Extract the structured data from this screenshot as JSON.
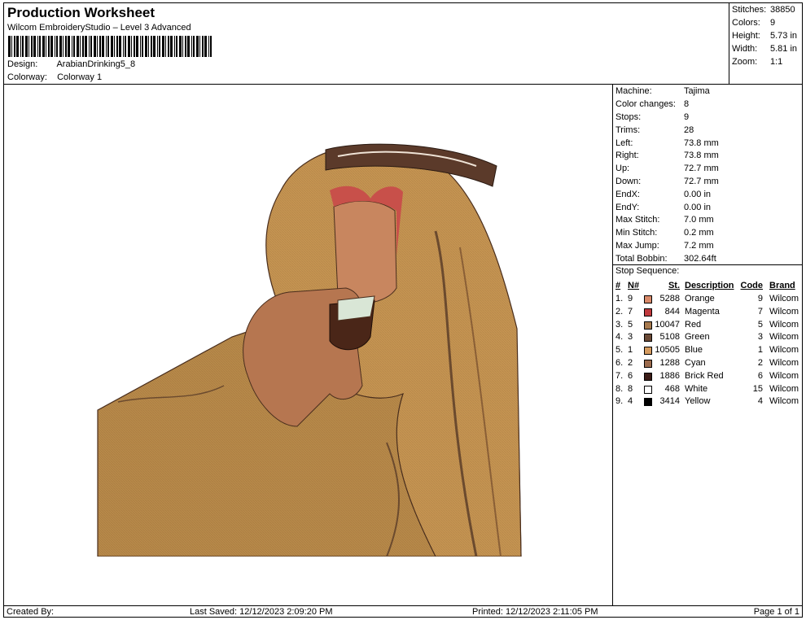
{
  "header": {
    "title": "Production Worksheet",
    "subtitle": "Wilcom EmbroideryStudio – Level 3 Advanced",
    "design_label": "Design:",
    "design_value": "ArabianDrinking5_8",
    "colorway_label": "Colorway:",
    "colorway_value": "Colorway 1"
  },
  "summary": [
    {
      "k": "Stitches:",
      "v": "38850"
    },
    {
      "k": "Colors:",
      "v": "9"
    },
    {
      "k": "Height:",
      "v": "5.73 in"
    },
    {
      "k": "Width:",
      "v": "5.81 in"
    },
    {
      "k": "Zoom:",
      "v": "1:1"
    }
  ],
  "machine": [
    {
      "k": "Machine:",
      "v": "Tajima"
    },
    {
      "k": "Color changes:",
      "v": "8"
    },
    {
      "k": "Stops:",
      "v": "9"
    },
    {
      "k": "Trims:",
      "v": "28"
    },
    {
      "k": "Left:",
      "v": "73.8 mm"
    },
    {
      "k": "Right:",
      "v": "73.8 mm"
    },
    {
      "k": "Up:",
      "v": "72.7 mm"
    },
    {
      "k": "Down:",
      "v": "72.7 mm"
    },
    {
      "k": "EndX:",
      "v": "0.00 in"
    },
    {
      "k": "EndY:",
      "v": "0.00 in"
    },
    {
      "k": "Max Stitch:",
      "v": "7.0 mm"
    },
    {
      "k": "Min Stitch:",
      "v": "0.2 mm"
    },
    {
      "k": "Max Jump:",
      "v": "7.2 mm"
    },
    {
      "k": "Total Bobbin:",
      "v": "302.64ft"
    }
  ],
  "stop_sequence": {
    "title": "Stop Sequence:",
    "headers": {
      "num": "#",
      "n": "N#",
      "st": "St.",
      "desc": "Description",
      "code": "Code",
      "brand": "Brand"
    },
    "rows": [
      {
        "num": "1.",
        "n": "9",
        "color": "#d98a6a",
        "st": "5288",
        "desc": "Orange",
        "code": "9",
        "brand": "Wilcom"
      },
      {
        "num": "2.",
        "n": "7",
        "color": "#c0393d",
        "st": "844",
        "desc": "Magenta",
        "code": "7",
        "brand": "Wilcom"
      },
      {
        "num": "3.",
        "n": "5",
        "color": "#a77a4e",
        "st": "10047",
        "desc": "Red",
        "code": "5",
        "brand": "Wilcom"
      },
      {
        "num": "4.",
        "n": "3",
        "color": "#6b4a36",
        "st": "5108",
        "desc": "Green",
        "code": "3",
        "brand": "Wilcom"
      },
      {
        "num": "5.",
        "n": "1",
        "color": "#d59b5f",
        "st": "10505",
        "desc": "Blue",
        "code": "1",
        "brand": "Wilcom"
      },
      {
        "num": "6.",
        "n": "2",
        "color": "#9c6b4d",
        "st": "1288",
        "desc": "Cyan",
        "code": "2",
        "brand": "Wilcom"
      },
      {
        "num": "7.",
        "n": "6",
        "color": "#3b1c17",
        "st": "1886",
        "desc": "Brick Red",
        "code": "6",
        "brand": "Wilcom"
      },
      {
        "num": "8.",
        "n": "8",
        "color": "#ffffff",
        "st": "468",
        "desc": "White",
        "code": "15",
        "brand": "Wilcom"
      },
      {
        "num": "9.",
        "n": "4",
        "color": "#000000",
        "st": "3414",
        "desc": "Yellow",
        "code": "4",
        "brand": "Wilcom"
      }
    ]
  },
  "footer": {
    "created": "Created By:",
    "saved": "Last Saved: 12/12/2023 2:09:20 PM",
    "printed": "Printed: 12/12/2023 2:11:05 PM",
    "page": "Page 1 of 1"
  }
}
